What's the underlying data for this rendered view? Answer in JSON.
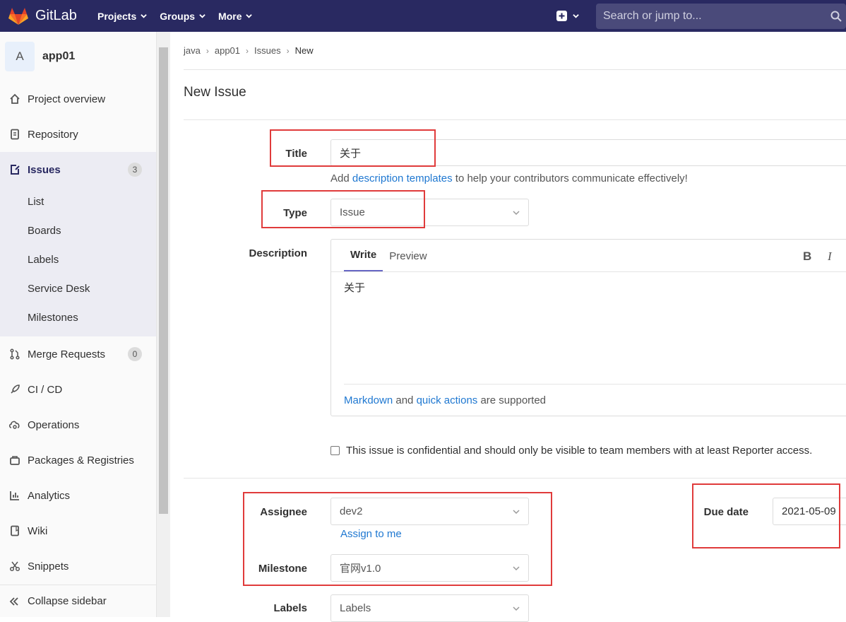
{
  "navbar": {
    "brand": "GitLab",
    "items": [
      {
        "label": "Projects"
      },
      {
        "label": "Groups"
      },
      {
        "label": "More"
      }
    ],
    "search_placeholder": "Search or jump to..."
  },
  "sidebar": {
    "project_initial": "A",
    "project_name": "app01",
    "items": [
      {
        "label": "Project overview",
        "icon": "home-icon"
      },
      {
        "label": "Repository",
        "icon": "book-icon"
      },
      {
        "label": "Issues",
        "icon": "issues-icon",
        "badge": "3",
        "active": true
      },
      {
        "label": "Merge Requests",
        "icon": "merge-request-icon",
        "badge": "0"
      },
      {
        "label": "CI / CD",
        "icon": "rocket-icon"
      },
      {
        "label": "Operations",
        "icon": "cloud-gear-icon"
      },
      {
        "label": "Packages & Registries",
        "icon": "package-icon"
      },
      {
        "label": "Analytics",
        "icon": "chart-icon"
      },
      {
        "label": "Wiki",
        "icon": "wiki-book-icon"
      },
      {
        "label": "Snippets",
        "icon": "scissors-icon"
      }
    ],
    "issues_sub": [
      "List",
      "Boards",
      "Labels",
      "Service Desk",
      "Milestones"
    ],
    "collapse_label": "Collapse sidebar"
  },
  "breadcrumb": [
    "java",
    "app01",
    "Issues",
    "New"
  ],
  "page_title": "New Issue",
  "form": {
    "title_label": "Title",
    "title_value": "关于",
    "templates_hint_pre": "Add ",
    "templates_hint_link": "description templates",
    "templates_hint_post": " to help your contributors communicate effectively!",
    "type_label": "Type",
    "type_value": "Issue",
    "description_label": "Description",
    "tab_write": "Write",
    "tab_preview": "Preview",
    "bold_tool": "B",
    "italic_tool": "I",
    "description_value": "关于",
    "md_link": "Markdown",
    "md_and": " and ",
    "qa_link": "quick actions",
    "md_post": " are supported",
    "confidential_text": "This issue is confidential and should only be visible to team members with at least Reporter access.",
    "assignee_label": "Assignee",
    "assignee_value": "dev2",
    "assign_to_me": "Assign to me",
    "milestone_label": "Milestone",
    "milestone_value": "官网v1.0",
    "labels_label": "Labels",
    "labels_value": "Labels",
    "due_date_label": "Due date",
    "due_date_value": "2021-05-09"
  },
  "colors": {
    "navbar_bg": "#292961",
    "link": "#1f78d1",
    "highlight_box": "#e03b3b"
  }
}
